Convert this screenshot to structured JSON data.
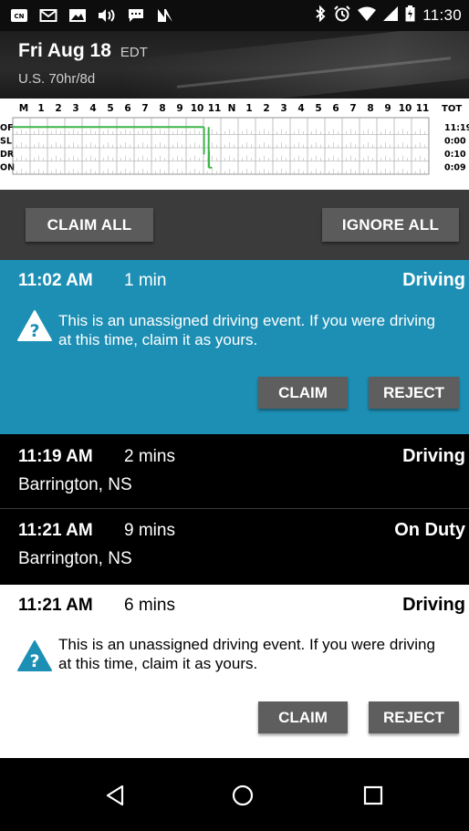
{
  "status_bar": {
    "left_icons": [
      "cbc-news-icon",
      "email-icon",
      "image-icon",
      "cast-audio-icon",
      "chat-icon",
      "n-app-icon"
    ],
    "right_icons": [
      "bluetooth-icon",
      "alarm-icon",
      "wifi-icon",
      "signal-icon",
      "battery-icon"
    ],
    "time": "11:30"
  },
  "header": {
    "date": "Fri Aug 18",
    "timezone": "EDT",
    "ruleset": "U.S. 70hr/8d"
  },
  "log_grid": {
    "hour_labels": [
      "M",
      "1",
      "2",
      "3",
      "4",
      "5",
      "6",
      "7",
      "8",
      "9",
      "10",
      "11",
      "N",
      "1",
      "2",
      "3",
      "4",
      "5",
      "6",
      "7",
      "8",
      "9",
      "10",
      "11"
    ],
    "tot_label": "TOT",
    "rows": [
      {
        "label": "OF",
        "total": "11:19"
      },
      {
        "label": "SL",
        "total": "0:00"
      },
      {
        "label": "DR",
        "total": "0:10"
      },
      {
        "label": "ON",
        "total": "0:09"
      }
    ],
    "line_color": "#3db54a"
  },
  "actions": {
    "claim_all": "CLAIM ALL",
    "ignore_all": "IGNORE ALL"
  },
  "events": [
    {
      "time": "11:02 AM",
      "duration": "1 min",
      "status": "Driving",
      "message": "This is an unassigned driving event. If you were driving at this time, claim it as yours.",
      "claim": "CLAIM",
      "reject": "REJECT"
    },
    {
      "time": "11:19 AM",
      "duration": "2 mins",
      "status": "Driving",
      "location": "Barrington, NS"
    },
    {
      "time": "11:21 AM",
      "duration": "9 mins",
      "status": "On Duty",
      "location": "Barrington, NS"
    },
    {
      "time": "11:21 AM",
      "duration": "6 mins",
      "status": "Driving",
      "message": "This is an unassigned driving event. If you were driving at this time, claim it as yours.",
      "claim": "CLAIM",
      "reject": "REJECT"
    }
  ],
  "nav": {
    "back": "back-icon",
    "home": "home-icon",
    "recents": "recents-icon"
  }
}
